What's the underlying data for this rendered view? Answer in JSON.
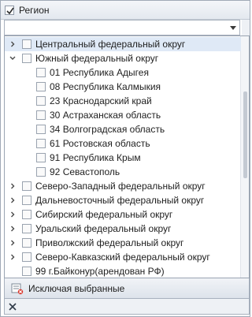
{
  "header": {
    "title": "Регион",
    "checked": true
  },
  "combo": {
    "value": ""
  },
  "tree": {
    "items": [
      {
        "label": "Центральный федеральный округ",
        "expanded": false,
        "selected": true
      },
      {
        "label": "Южный федеральный округ",
        "expanded": true,
        "selected": false,
        "children": [
          {
            "code": "01",
            "name": "Республика Адыгея"
          },
          {
            "code": "08",
            "name": "Республика Калмыкия"
          },
          {
            "code": "23",
            "name": "Краснодарский край"
          },
          {
            "code": "30",
            "name": "Астраханская область"
          },
          {
            "code": "34",
            "name": "Волгоградская область"
          },
          {
            "code": "61",
            "name": "Ростовская область"
          },
          {
            "code": "91",
            "name": "Республика Крым"
          },
          {
            "code": "92",
            "name": "Севастополь"
          }
        ]
      },
      {
        "label": "Северо-Западный федеральный округ",
        "expanded": false,
        "selected": false
      },
      {
        "label": "Дальневосточный федеральный округ",
        "expanded": false,
        "selected": false
      },
      {
        "label": "Сибирский федеральный округ",
        "expanded": false,
        "selected": false
      },
      {
        "label": "Уральский федеральный округ",
        "expanded": false,
        "selected": false
      },
      {
        "label": "Приволжский федеральный округ",
        "expanded": false,
        "selected": false
      },
      {
        "label": "Северо-Кавказский федеральный округ",
        "expanded": false,
        "selected": false
      }
    ],
    "leaf": {
      "code": "99",
      "name": "г.Байконур(арендован РФ)"
    }
  },
  "footer": {
    "exclude_label": "Исключая выбранные"
  },
  "colors": {
    "selection": "#dfe9f6",
    "border": "#a8b1be"
  }
}
